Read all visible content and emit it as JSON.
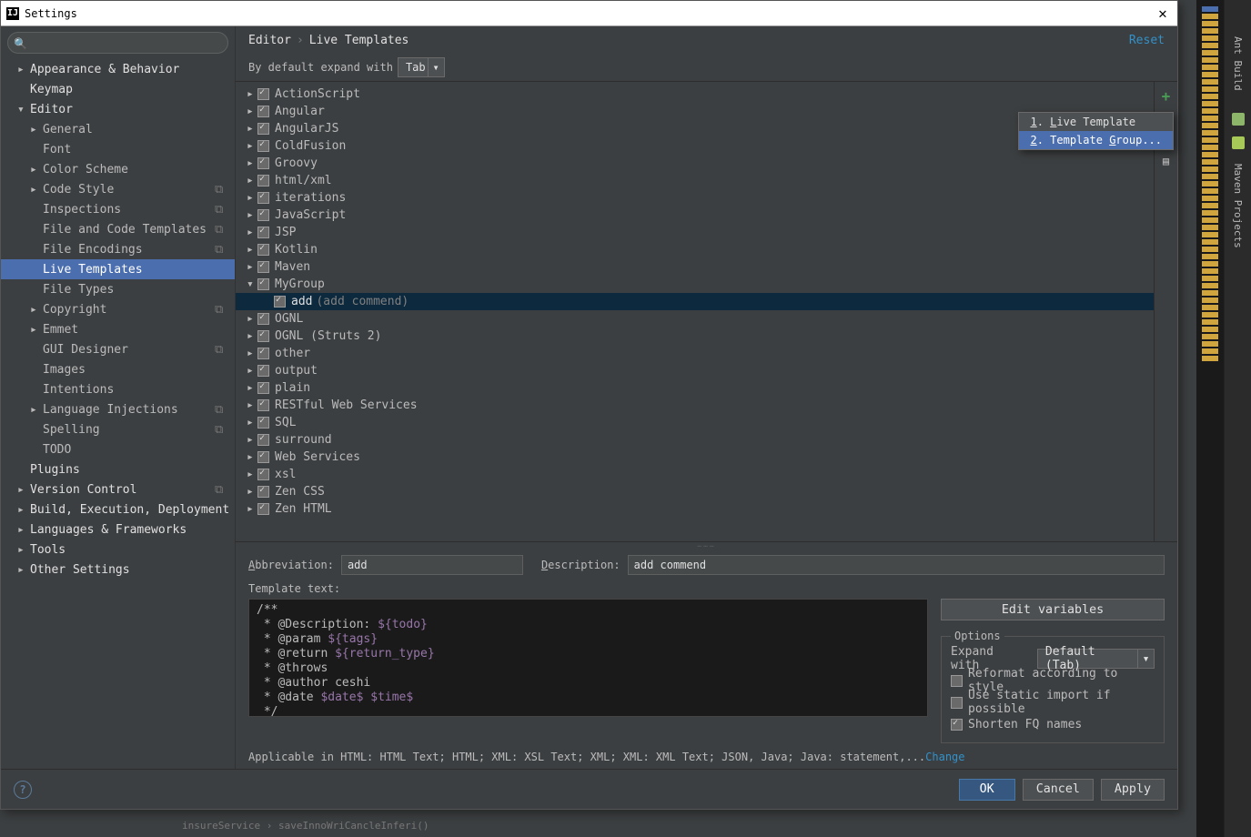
{
  "window": {
    "title": "Settings"
  },
  "sidebar": {
    "items": [
      {
        "label": "Appearance & Behavior",
        "lvl": 1,
        "tri": "closed",
        "bold": true
      },
      {
        "label": "Keymap",
        "lvl": 1,
        "tri": "none",
        "bold": true
      },
      {
        "label": "Editor",
        "lvl": 1,
        "tri": "open",
        "bold": true
      },
      {
        "label": "General",
        "lvl": 2,
        "tri": "closed"
      },
      {
        "label": "Font",
        "lvl": 2,
        "tri": "none"
      },
      {
        "label": "Color Scheme",
        "lvl": 2,
        "tri": "closed"
      },
      {
        "label": "Code Style",
        "lvl": 2,
        "tri": "closed",
        "ind": true
      },
      {
        "label": "Inspections",
        "lvl": 2,
        "tri": "none",
        "ind": true
      },
      {
        "label": "File and Code Templates",
        "lvl": 2,
        "tri": "none",
        "ind": true
      },
      {
        "label": "File Encodings",
        "lvl": 2,
        "tri": "none",
        "ind": true
      },
      {
        "label": "Live Templates",
        "lvl": 2,
        "tri": "none",
        "selected": true
      },
      {
        "label": "File Types",
        "lvl": 2,
        "tri": "none"
      },
      {
        "label": "Copyright",
        "lvl": 2,
        "tri": "closed",
        "ind": true
      },
      {
        "label": "Emmet",
        "lvl": 2,
        "tri": "closed"
      },
      {
        "label": "GUI Designer",
        "lvl": 2,
        "tri": "none",
        "ind": true
      },
      {
        "label": "Images",
        "lvl": 2,
        "tri": "none"
      },
      {
        "label": "Intentions",
        "lvl": 2,
        "tri": "none"
      },
      {
        "label": "Language Injections",
        "lvl": 2,
        "tri": "closed",
        "ind": true
      },
      {
        "label": "Spelling",
        "lvl": 2,
        "tri": "none",
        "ind": true
      },
      {
        "label": "TODO",
        "lvl": 2,
        "tri": "none"
      },
      {
        "label": "Plugins",
        "lvl": 1,
        "tri": "none",
        "bold": true
      },
      {
        "label": "Version Control",
        "lvl": 1,
        "tri": "closed",
        "bold": true,
        "ind": true
      },
      {
        "label": "Build, Execution, Deployment",
        "lvl": 1,
        "tri": "closed",
        "bold": true
      },
      {
        "label": "Languages & Frameworks",
        "lvl": 1,
        "tri": "closed",
        "bold": true
      },
      {
        "label": "Tools",
        "lvl": 1,
        "tri": "closed",
        "bold": true
      },
      {
        "label": "Other Settings",
        "lvl": 1,
        "tri": "closed",
        "bold": true
      }
    ]
  },
  "header": {
    "crumb1": "Editor",
    "crumb2": "Live Templates",
    "reset": "Reset"
  },
  "expand": {
    "label": "By default expand with",
    "value": "Tab"
  },
  "templates": [
    {
      "label": "ActionScript",
      "tri": "closed",
      "chk": true
    },
    {
      "label": "Angular",
      "tri": "closed",
      "chk": true
    },
    {
      "label": "AngularJS",
      "tri": "closed",
      "chk": true
    },
    {
      "label": "ColdFusion",
      "tri": "closed",
      "chk": true
    },
    {
      "label": "Groovy",
      "tri": "closed",
      "chk": true
    },
    {
      "label": "html/xml",
      "tri": "closed",
      "chk": true
    },
    {
      "label": "iterations",
      "tri": "closed",
      "chk": true
    },
    {
      "label": "JavaScript",
      "tri": "closed",
      "chk": true
    },
    {
      "label": "JSP",
      "tri": "closed",
      "chk": true
    },
    {
      "label": "Kotlin",
      "tri": "closed",
      "chk": true
    },
    {
      "label": "Maven",
      "tri": "closed",
      "chk": true
    },
    {
      "label": "MyGroup",
      "tri": "open",
      "chk": true
    },
    {
      "label": "add",
      "desc": "(add commend)",
      "tri": "none",
      "chk": true,
      "child": true,
      "selected": true
    },
    {
      "label": "OGNL",
      "tri": "closed",
      "chk": true
    },
    {
      "label": "OGNL (Struts 2)",
      "tri": "closed",
      "chk": true
    },
    {
      "label": "other",
      "tri": "closed",
      "chk": true
    },
    {
      "label": "output",
      "tri": "closed",
      "chk": true
    },
    {
      "label": "plain",
      "tri": "closed",
      "chk": true
    },
    {
      "label": "RESTful Web Services",
      "tri": "closed",
      "chk": true
    },
    {
      "label": "SQL",
      "tri": "closed",
      "chk": true
    },
    {
      "label": "surround",
      "tri": "closed",
      "chk": true
    },
    {
      "label": "Web Services",
      "tri": "closed",
      "chk": true
    },
    {
      "label": "xsl",
      "tri": "closed",
      "chk": true
    },
    {
      "label": "Zen CSS",
      "tri": "closed",
      "chk": true
    },
    {
      "label": "Zen HTML",
      "tri": "closed",
      "chk": true
    }
  ],
  "popup": {
    "item1": "1. Live Template",
    "item2": "2. Template Group..."
  },
  "detail": {
    "abbr_label": "Abbreviation:",
    "abbr_value": "add",
    "desc_label": "Description:",
    "desc_value": "add commend",
    "tt_label": "Template text:",
    "code_lines": [
      {
        "t": "/**"
      },
      {
        "t": " * @Description: ",
        "v": "${todo}"
      },
      {
        "t": " * @param ",
        "v": "${tags}"
      },
      {
        "t": " * @return ",
        "v": "${return_type}"
      },
      {
        "t": " * @throws"
      },
      {
        "t": " * @author ceshi"
      },
      {
        "t": " * @date ",
        "v": "$date$ $time$"
      },
      {
        "t": " */"
      }
    ],
    "edit_vars": "Edit variables",
    "options_title": "Options",
    "expand_label": "Expand with",
    "expand_value": "Default (Tab)",
    "reformat": "Reformat according to style",
    "static_import": "Use static import if possible",
    "shorten": "Shorten FQ names",
    "applicable": "Applicable in HTML: HTML Text; HTML; XML: XSL Text; XML; XML: XML Text; JSON, Java; Java: statement,...",
    "change": "Change"
  },
  "footer": {
    "ok": "OK",
    "cancel": "Cancel",
    "apply": "Apply"
  },
  "behind_bar": "insureService  ›  saveInnoWriCancleInferi()",
  "tool_strip": {
    "ant": "Ant Build",
    "maven": "Maven Projects"
  }
}
